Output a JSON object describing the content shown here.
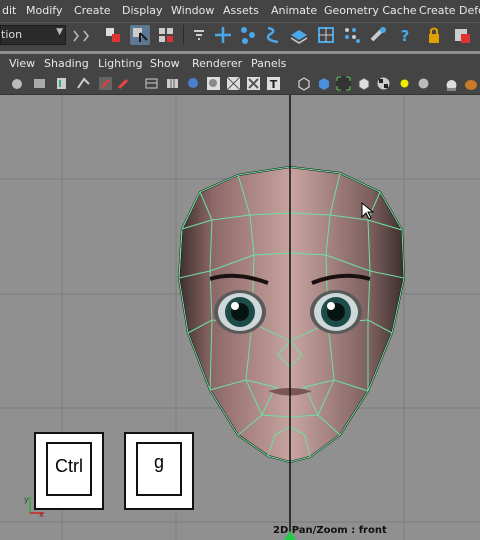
{
  "main_menu": [
    "dit",
    "Modify",
    "Create",
    "Display",
    "Window",
    "Assets",
    "Animate",
    "Geometry Cache",
    "Create Defo"
  ],
  "mode_select": {
    "value": "tion"
  },
  "panel_menu": [
    "View",
    "Shading",
    "Lighting",
    "Show",
    "Renderer",
    "Panels"
  ],
  "toolbar_icons": [
    "select-tool-icon",
    "lasso-select-icon",
    "paint-select-icon",
    "filter-icon",
    "move-icon",
    "curve-snap-icon",
    "surface-snap-icon",
    "plane-snap-icon",
    "grid-snap-icon",
    "point-snap-icon",
    "magnet-icon",
    "help-icon",
    "lock-icon",
    "render-icon"
  ],
  "overlay_keys": {
    "ctrl": "Ctrl",
    "g": "g"
  },
  "viewport": {
    "camera_label": "2D Pan/Zoom : front"
  }
}
